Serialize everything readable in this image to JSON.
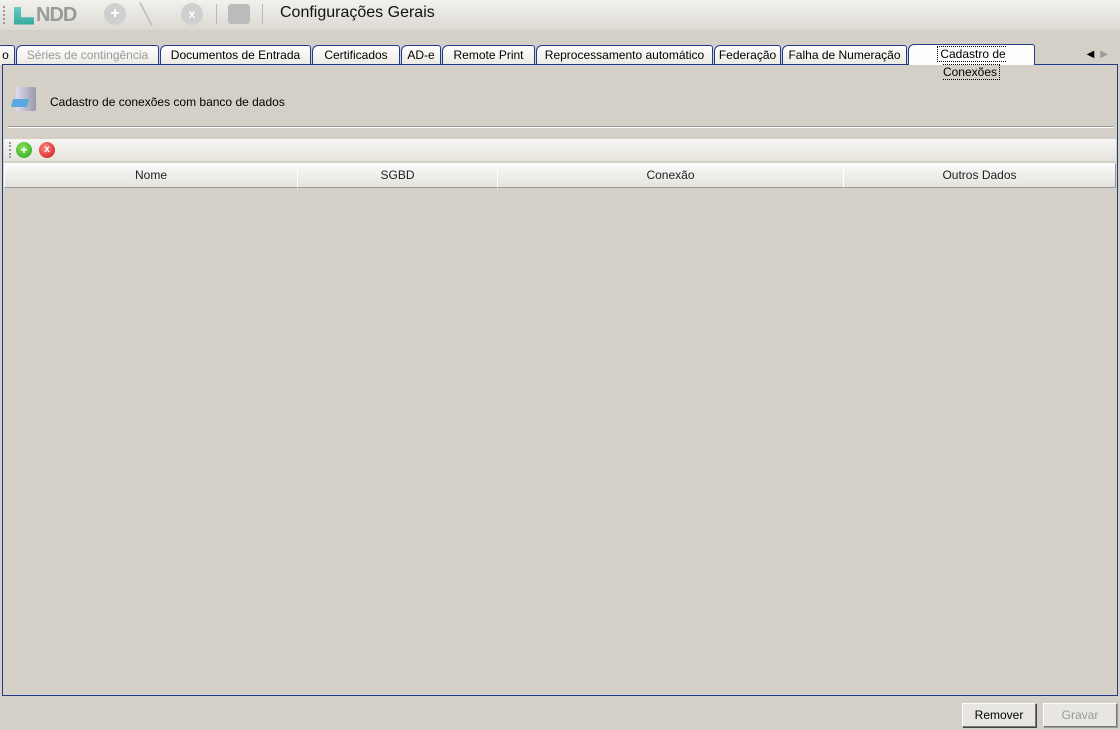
{
  "window": {
    "title": "Configurações Gerais",
    "logo_text": "NDD"
  },
  "tabs": [
    {
      "label": "o",
      "state": "normal"
    },
    {
      "label": "Séries de contingência",
      "state": "disabled"
    },
    {
      "label": "Documentos de Entrada",
      "state": "normal"
    },
    {
      "label": "Certificados",
      "state": "normal"
    },
    {
      "label": "AD-e",
      "state": "normal"
    },
    {
      "label": "Remote Print",
      "state": "normal"
    },
    {
      "label": "Reprocessamento automático",
      "state": "normal"
    },
    {
      "label": "Federação",
      "state": "normal"
    },
    {
      "label": "Falha de Numeração",
      "state": "normal"
    },
    {
      "label": "Cadastro de Conexões",
      "state": "active"
    }
  ],
  "panel": {
    "header": "Cadastro de conexões com banco de dados"
  },
  "grid": {
    "columns": [
      "Nome",
      "SGBD",
      "Conexão",
      "Outros Dados"
    ],
    "rows": []
  },
  "buttons": {
    "remove": "Remover",
    "save": "Gravar"
  }
}
